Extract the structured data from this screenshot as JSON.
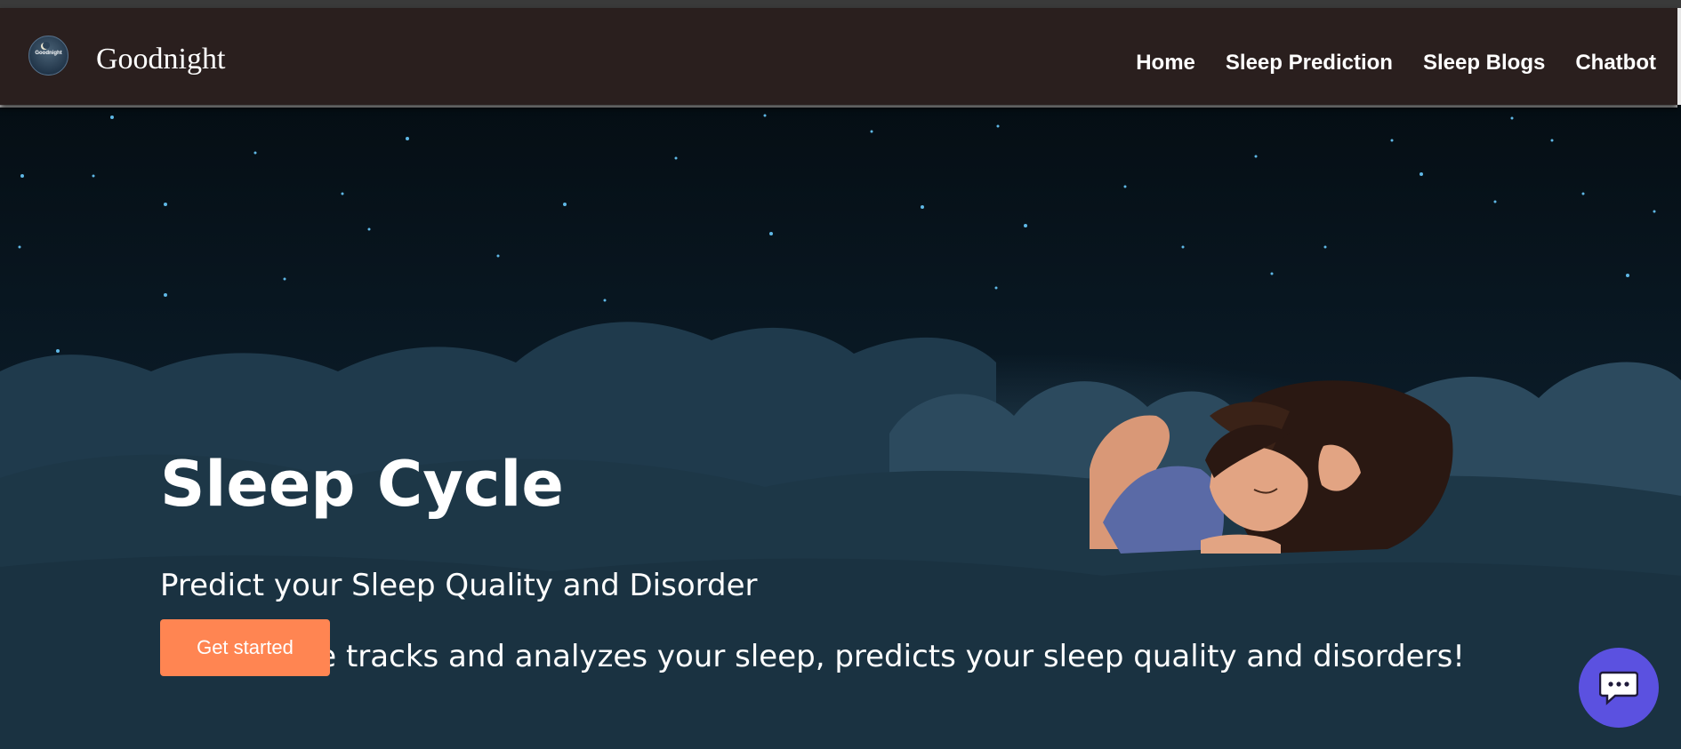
{
  "nav": {
    "brand": "Goodnight",
    "logo_text": "Goodnight",
    "links": [
      "Home",
      "Sleep Prediction",
      "Sleep Blogs",
      "Chatbot"
    ]
  },
  "hero": {
    "title": "Sleep Cycle",
    "subtitle": "Predict your Sleep Quality and Disorder",
    "description": "Sleep Cycle tracks and analyzes your sleep, predicts your sleep quality and disorders!",
    "cta_label": "Get started"
  },
  "colors": {
    "navbar_bg": "#2a1f1e",
    "sky_bg": "#08141d",
    "cloud": "#2c4a5e",
    "accent_button": "#ff8552",
    "chat_button": "#5b51e0"
  },
  "icons": {
    "chat": "chat-bubble-icon",
    "logo": "moon-logo-icon"
  }
}
